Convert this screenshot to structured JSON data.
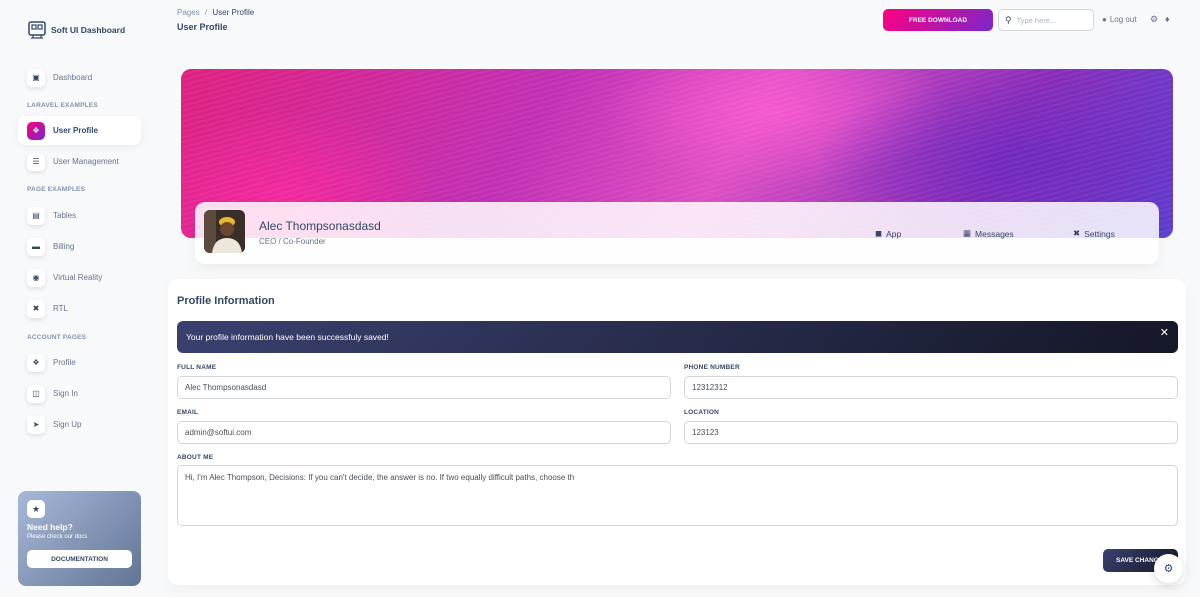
{
  "brand": {
    "name": "Soft UI Dashboard"
  },
  "sidebar": {
    "dashboard": "Dashboard",
    "sections": [
      "Laravel Examples",
      "Page Examples",
      "Account Pages"
    ],
    "laravel": [
      "User Profile",
      "User Management"
    ],
    "pages": [
      "Tables",
      "Billing",
      "Virtual Reality",
      "RTL"
    ],
    "account": [
      "Profile",
      "Sign In",
      "Sign Up"
    ],
    "help": {
      "title": "Need help?",
      "subtitle": "Please check our docs",
      "button": "DOCUMENTATION"
    }
  },
  "navbar": {
    "breadcrumb_root": "Pages",
    "breadcrumb_sep": "/",
    "breadcrumb_current": "User Profile",
    "title": "User Profile",
    "download": "FREE DOWNLOAD",
    "search_placeholder": "Type here...",
    "logout": "Log out"
  },
  "profile": {
    "name": "Alec Thompsonasdasd",
    "role": "CEO / Co-Founder",
    "tabs": [
      "App",
      "Messages",
      "Settings"
    ]
  },
  "form": {
    "title": "Profile Information",
    "alert": "Your profile information have been successfuly saved!",
    "labels": {
      "full_name": "Full Name",
      "phone": "Phone Number",
      "email": "Email",
      "location": "Location",
      "about": "About Me"
    },
    "values": {
      "full_name": "Alec Thompsonasdasd",
      "phone": "12312312",
      "email": "admin@softui.com",
      "location": "123123",
      "about": "Hi, I'm Alec Thompson, Decisions: If you can't decide, the answer is no. If two equally difficult paths, choose th"
    },
    "save": "SAVE CHANGES"
  },
  "colors": {
    "primary_gradient_start": "#7928ca",
    "primary_gradient_end": "#ff0080",
    "dark": "#344767"
  },
  "icons": [
    "logo-icon",
    "shop-icon",
    "user-icon",
    "list-icon",
    "table-icon",
    "billing-icon",
    "vr-icon",
    "rtl-icon",
    "profile-icon",
    "sign-in-icon",
    "sign-up-icon",
    "help-icon",
    "search-icon",
    "user-circle-icon",
    "gear-icon",
    "bell-icon",
    "cube-icon",
    "document-icon",
    "tools-icon",
    "close-icon"
  ]
}
